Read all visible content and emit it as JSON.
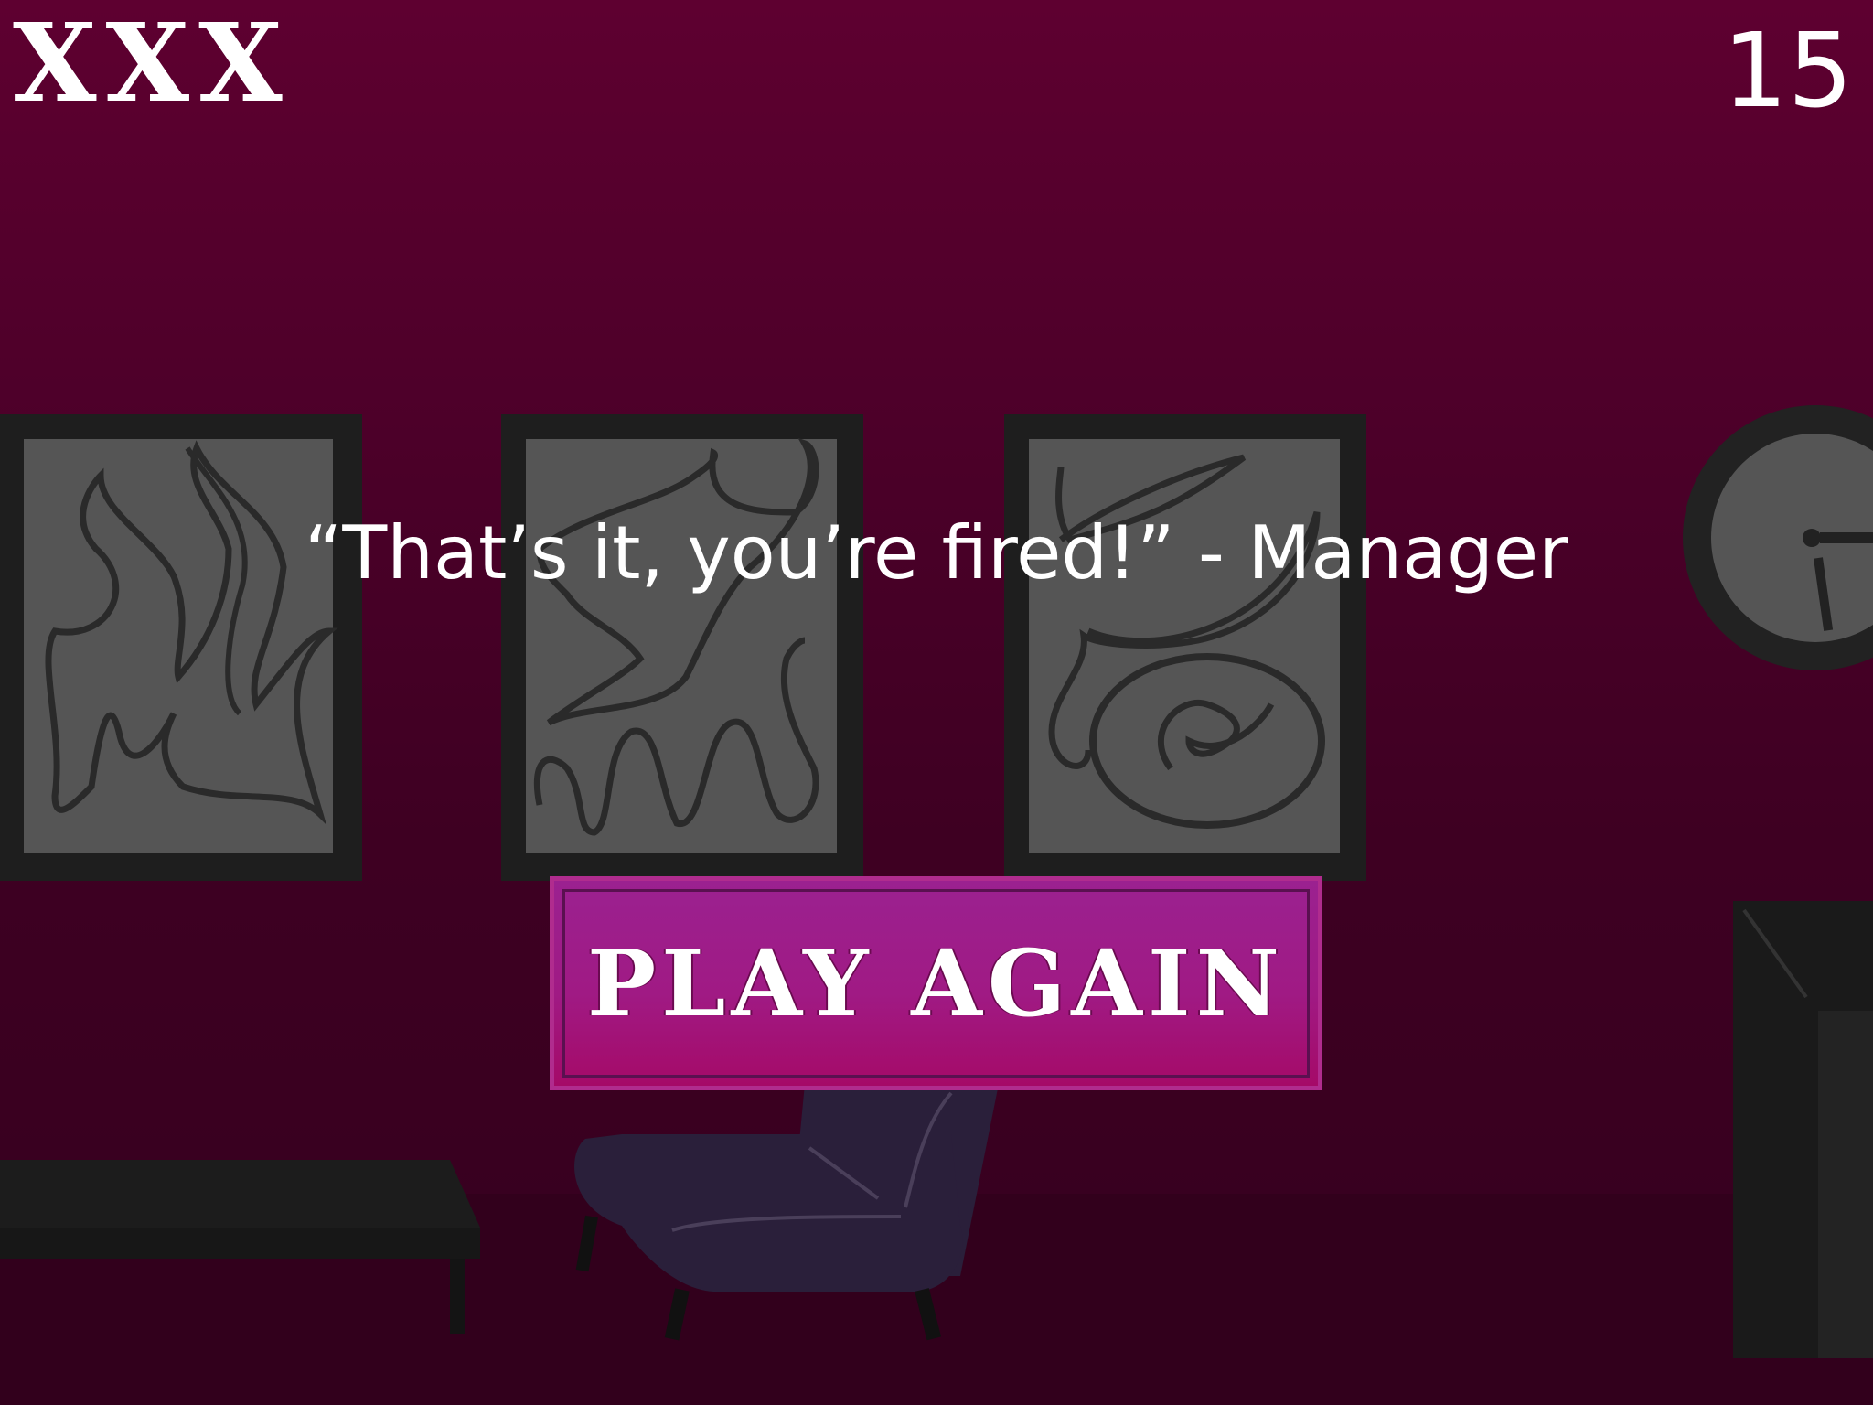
{
  "hud": {
    "lives": "XXX",
    "score": "15"
  },
  "quote": "“That’s it, you’re fired!” - Manager",
  "play_again_button": {
    "label": "PLAY AGAIN"
  },
  "colors": {
    "background_top": "#5e0030",
    "background_bottom": "#35001e",
    "button_fill": "#9b2190",
    "button_fill_bottom": "#a50a68",
    "text": "#ffffff"
  }
}
